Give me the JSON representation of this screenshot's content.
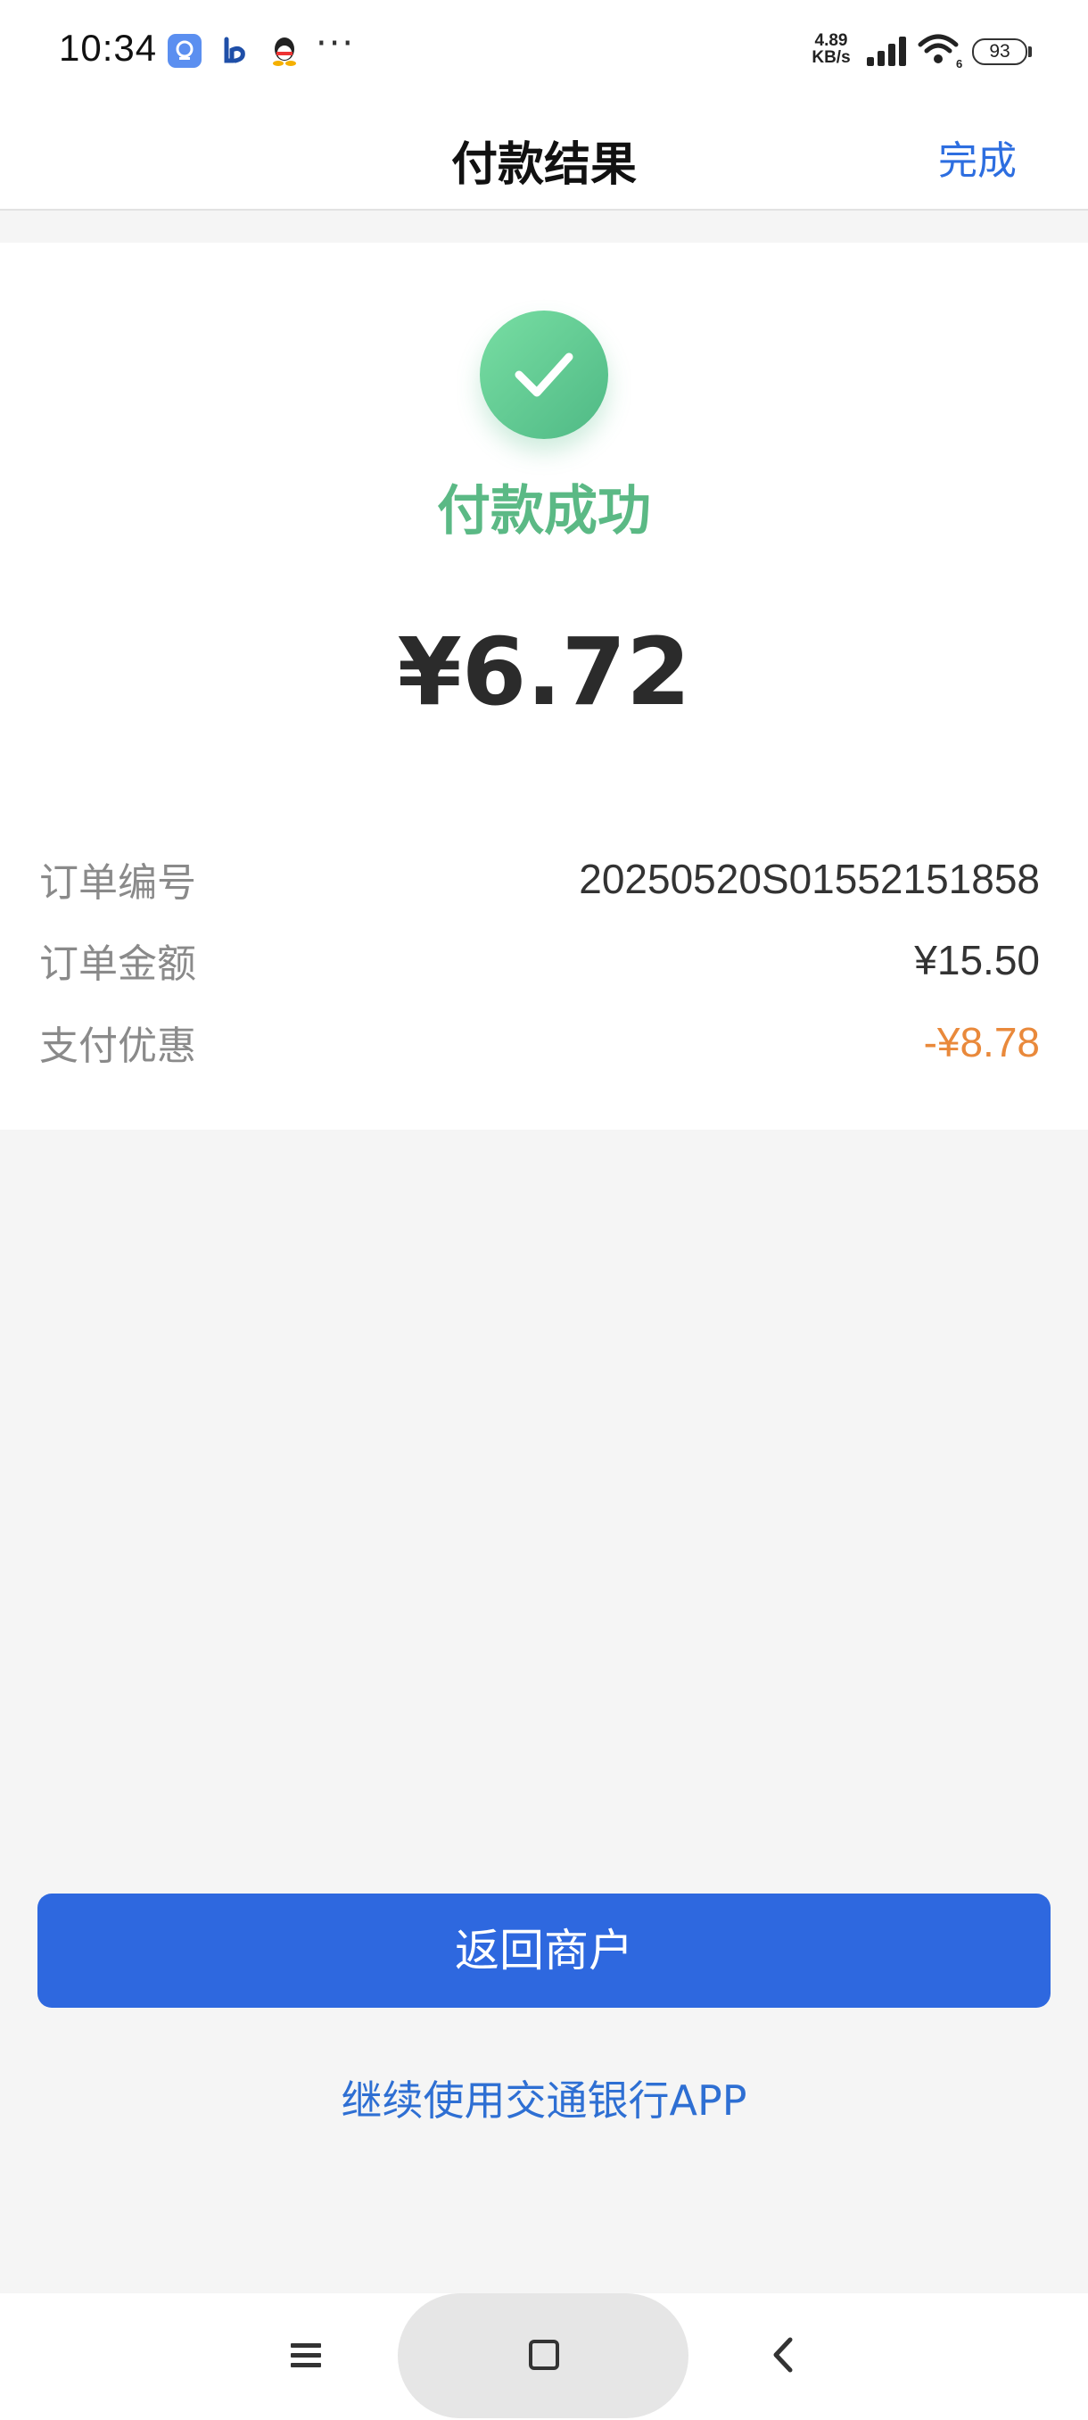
{
  "status_bar": {
    "time": "10:34",
    "more_dots": "···",
    "net_speed_value": "4.89",
    "net_speed_unit": "KB/s",
    "battery": "93"
  },
  "nav": {
    "title": "付款结果",
    "done_label": "完成"
  },
  "result": {
    "status_text": "付款成功",
    "amount": "¥6.72",
    "status_color": "#5bb985"
  },
  "details": [
    {
      "label": "订单编号",
      "value": "20250520S01552151858"
    },
    {
      "label": "订单金额",
      "value": "¥15.50"
    },
    {
      "label": "支付优惠",
      "value": "-¥8.78"
    }
  ],
  "actions": {
    "primary_label": "返回商户",
    "secondary_label": "继续使用交通银行APP",
    "primary_color": "#2e68df"
  },
  "icons": {
    "success": "check-circle-icon",
    "system_nav": [
      "menu-icon",
      "home-icon",
      "back-icon"
    ]
  }
}
